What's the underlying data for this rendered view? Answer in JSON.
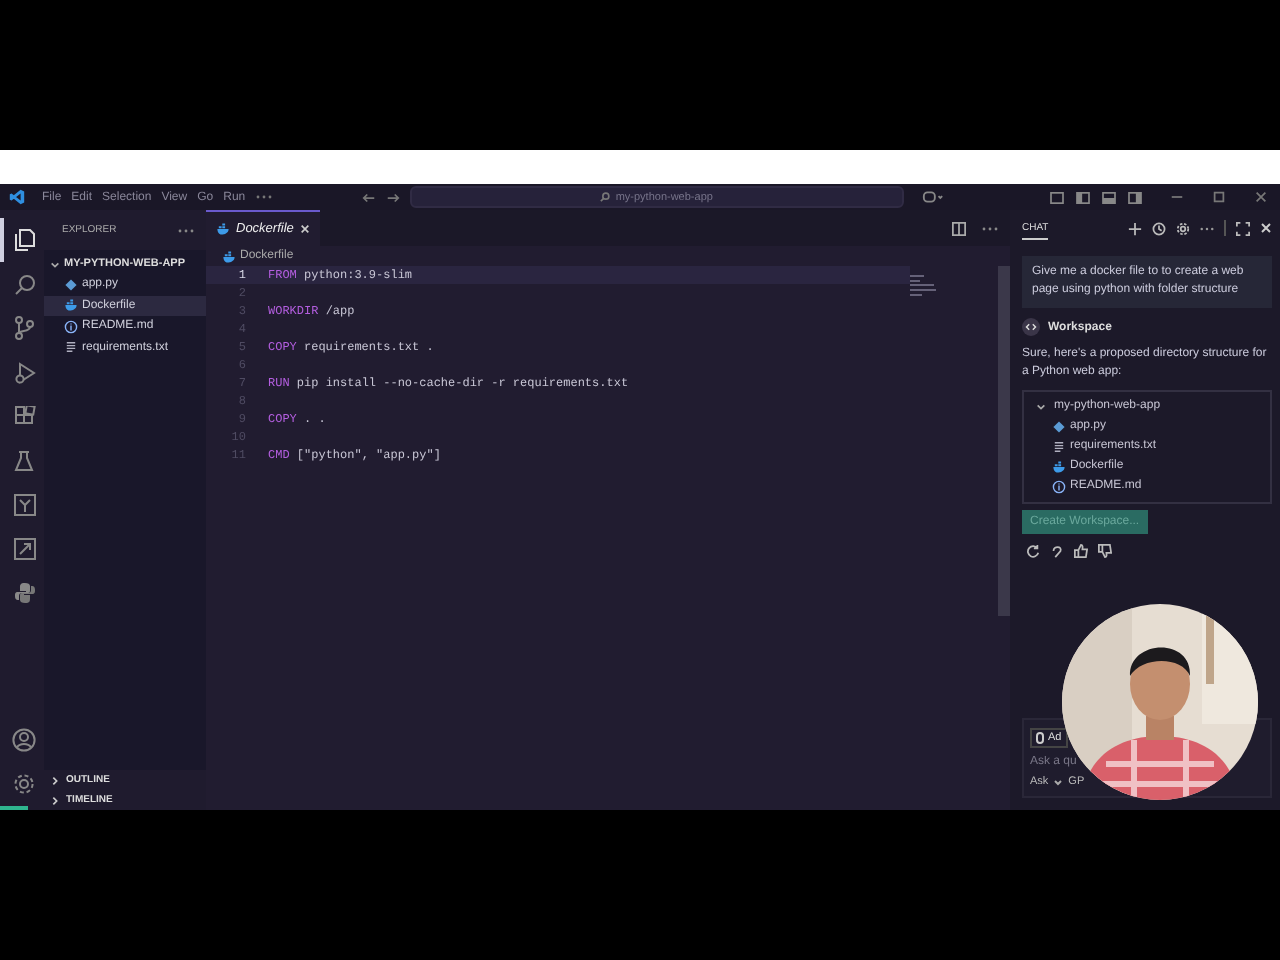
{
  "title_bar": {
    "menu": [
      "File",
      "Edit",
      "Selection",
      "View",
      "Go",
      "Run"
    ],
    "search": "my-python-web-app"
  },
  "activity_bar": [
    {
      "kind": "files",
      "selected": true
    },
    {
      "kind": "search",
      "selected": false
    },
    {
      "kind": "branch",
      "selected": false
    },
    {
      "kind": "debug",
      "selected": false
    },
    {
      "kind": "extensions",
      "selected": false
    },
    {
      "kind": "flask",
      "selected": false
    },
    {
      "kind": "square-y",
      "selected": false
    },
    {
      "kind": "square-arrow",
      "selected": false
    },
    {
      "kind": "snake",
      "selected": false
    }
  ],
  "activity_bottom": [
    {
      "kind": "account"
    },
    {
      "kind": "settings"
    }
  ],
  "explorer": {
    "title": "EXPLORER",
    "folder": {
      "name": "MY-PYTHON-WEB-APP",
      "expanded": true,
      "children": [
        {
          "name": "app.py",
          "kind": "python",
          "selected": false
        },
        {
          "name": "Dockerfile",
          "kind": "docker",
          "selected": true
        },
        {
          "name": "README.md",
          "kind": "info",
          "selected": false
        },
        {
          "name": "requirements.txt",
          "kind": "text",
          "selected": false
        }
      ]
    },
    "sections": [
      {
        "name": "OUTLINE",
        "expanded": false
      },
      {
        "name": "TIMELINE",
        "expanded": false
      }
    ]
  },
  "editor": {
    "tabs": [
      {
        "label": "Dockerfile",
        "selected": true
      }
    ],
    "breadcrumb": "Dockerfile",
    "lines": [
      {
        "number": "1",
        "keyword": "FROM",
        "rest": " python:3.9-slim",
        "current": true
      },
      {
        "number": "2",
        "current": false
      },
      {
        "number": "3",
        "keyword": "WORKDIR",
        "rest": " /app",
        "current": false
      },
      {
        "number": "4",
        "current": false
      },
      {
        "number": "5",
        "keyword": "COPY",
        "rest": " requirements.txt .",
        "current": false
      },
      {
        "number": "6",
        "current": false
      },
      {
        "number": "7",
        "keyword": "RUN",
        "rest": " pip install --no-cache-dir -r requirements.txt",
        "current": false
      },
      {
        "number": "8",
        "current": false
      },
      {
        "number": "9",
        "keyword": "COPY",
        "rest": " . .",
        "current": false
      },
      {
        "number": "10",
        "current": false
      },
      {
        "number": "11",
        "keyword": "CMD",
        "rest": " [\"python\", \"app.py\"]",
        "current": false
      }
    ]
  },
  "chat": {
    "title": "CHAT",
    "user_message": "Give me a docker file to to create a web page using python with folder structure",
    "agent": "Workspace",
    "reply": "Sure, here's a proposed directory structure for a Python web app:",
    "tree": {
      "name": "my-python-web-app",
      "expanded": true,
      "children": [
        {
          "name": "app.py",
          "kind": "python"
        },
        {
          "name": "requirements.txt",
          "kind": "text"
        },
        {
          "name": "Dockerfile",
          "kind": "docker"
        },
        {
          "name": "README.md",
          "kind": "info"
        }
      ]
    },
    "action": "Create Workspace...",
    "input": {
      "attach": "Ad",
      "placeholder": "Ask a qu",
      "mode": "Ask",
      "model": "GP"
    }
  }
}
